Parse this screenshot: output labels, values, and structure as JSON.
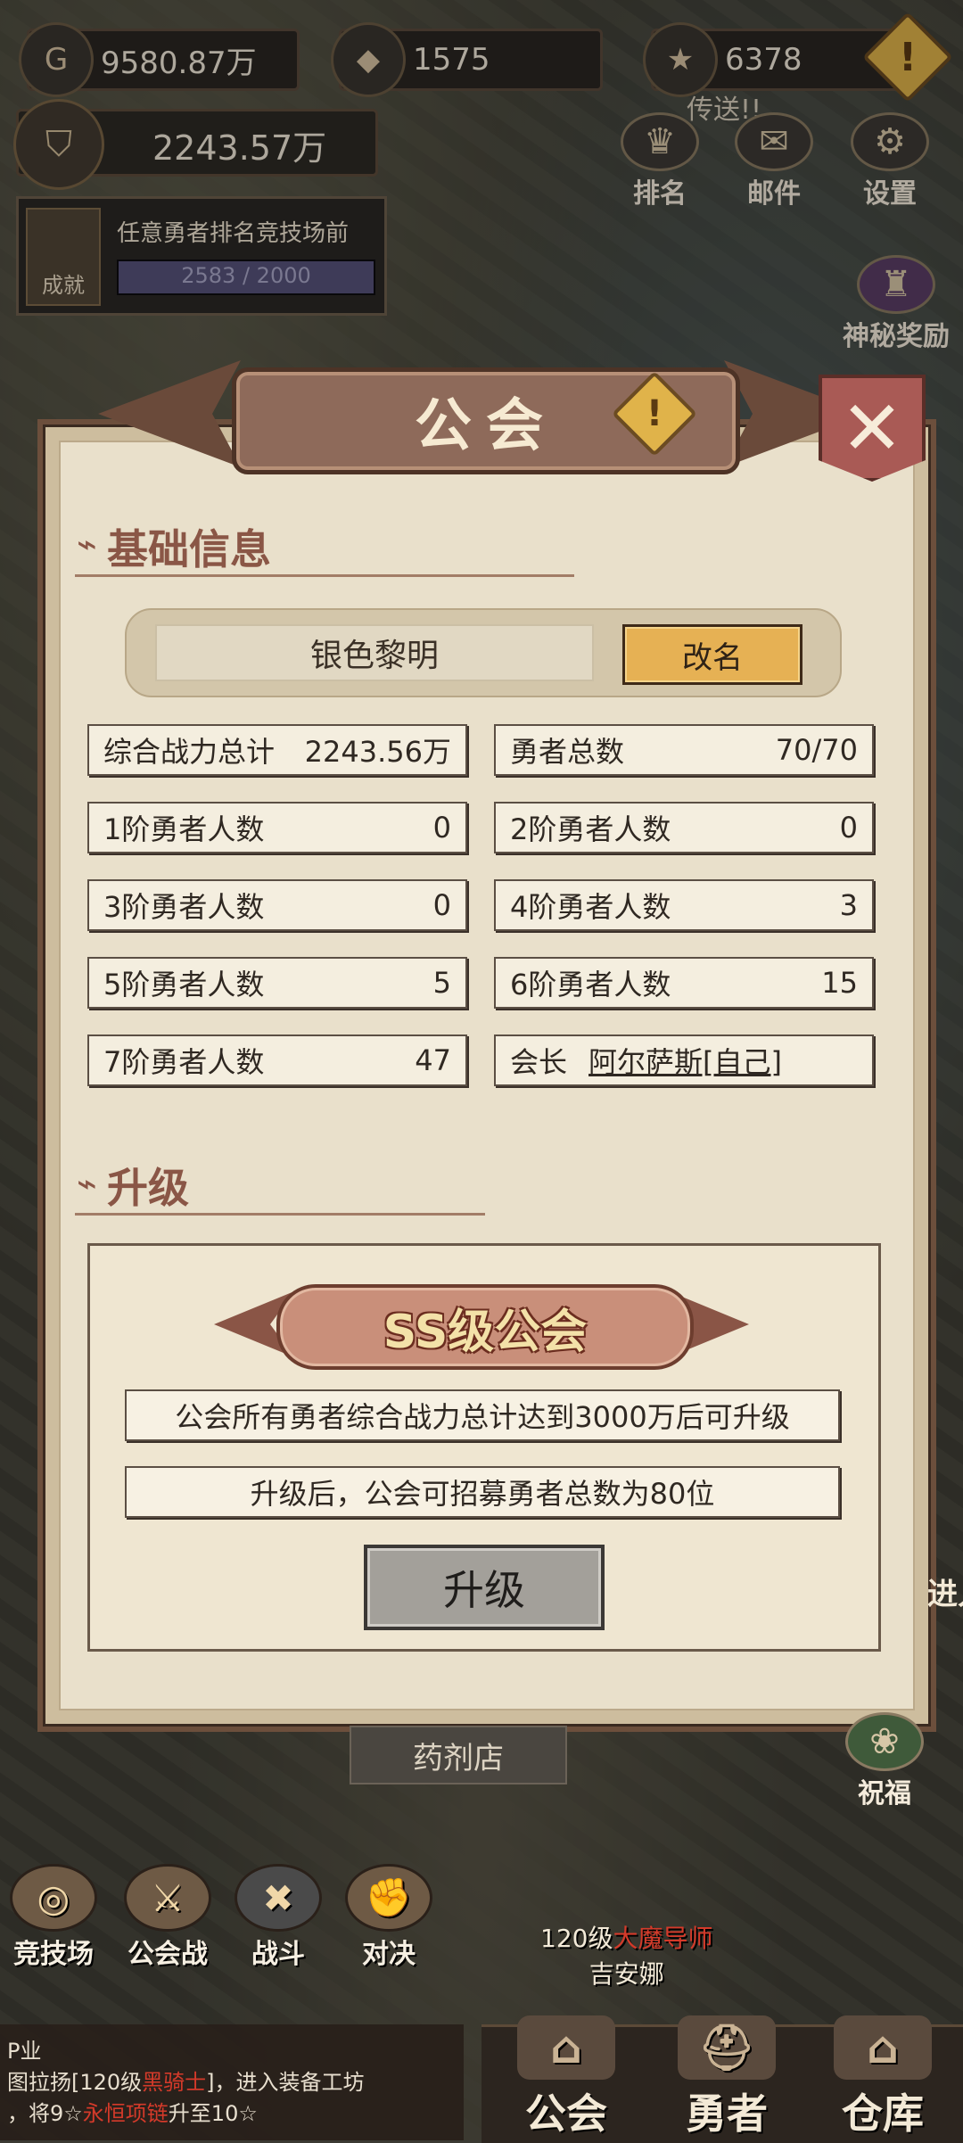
{
  "resources": {
    "gold": "9580.87万",
    "gem": "1575",
    "star": "6378"
  },
  "power": "2243.57万",
  "achievement": {
    "badge": "成就",
    "title": "任意勇者排名竞技场前",
    "progress_text": "2583 / 2000",
    "progress": 1.0
  },
  "top_menu": {
    "portal_text": "传送!!",
    "rank": "排名",
    "mail": "邮件",
    "settings": "设置",
    "mystery_reward": "神秘奖励"
  },
  "modal": {
    "title": "公会",
    "section_basic": "基础信息",
    "guild_name": "银色黎明",
    "rename": "改名",
    "stats": [
      {
        "k": "综合战力总计",
        "v": "2243.56万"
      },
      {
        "k": "勇者总数",
        "v": "70/70"
      },
      {
        "k": "1阶勇者人数",
        "v": "0"
      },
      {
        "k": "2阶勇者人数",
        "v": "0"
      },
      {
        "k": "3阶勇者人数",
        "v": "0"
      },
      {
        "k": "4阶勇者人数",
        "v": "3"
      },
      {
        "k": "5阶勇者人数",
        "v": "5"
      },
      {
        "k": "6阶勇者人数",
        "v": "15"
      },
      {
        "k": "7阶勇者人数",
        "v": "47"
      },
      {
        "k": "会长",
        "v": "阿尔萨斯[自己]"
      }
    ],
    "section_upgrade": "升级",
    "upgrade_title": "SS级公会",
    "upgrade_line1": "公会所有勇者综合战力总计达到3000万后可升级",
    "upgrade_line2": "升级后，公会可招募勇者总数为80位",
    "upgrade_button": "升级"
  },
  "shop_sign": "药剂店",
  "side": {
    "bless": "祝福",
    "enter": "进入"
  },
  "nav": {
    "arena": "竞技场",
    "guild_war": "公会战",
    "battle": "战斗",
    "duel": "对决"
  },
  "npc": {
    "level": "120级",
    "class": "大魔导师",
    "name": "吉安娜"
  },
  "chat": {
    "line0": "P业",
    "line1a": "图拉扬[120级",
    "line1b": "黑骑士",
    "line1c": "]，进入装备工坊",
    "line2a": "，将9☆",
    "line2b": "永恒项链",
    "line2c": "升至10☆"
  },
  "tabs": {
    "guild": "公会",
    "hero": "勇者",
    "warehouse": "仓库"
  },
  "colors": {
    "modal_bg": "#e9e0cb",
    "title_banner": "#8e6a5a",
    "rename_btn": "#e6b154",
    "close_btn": "#a95a55",
    "accent_red": "#d43a2a"
  }
}
